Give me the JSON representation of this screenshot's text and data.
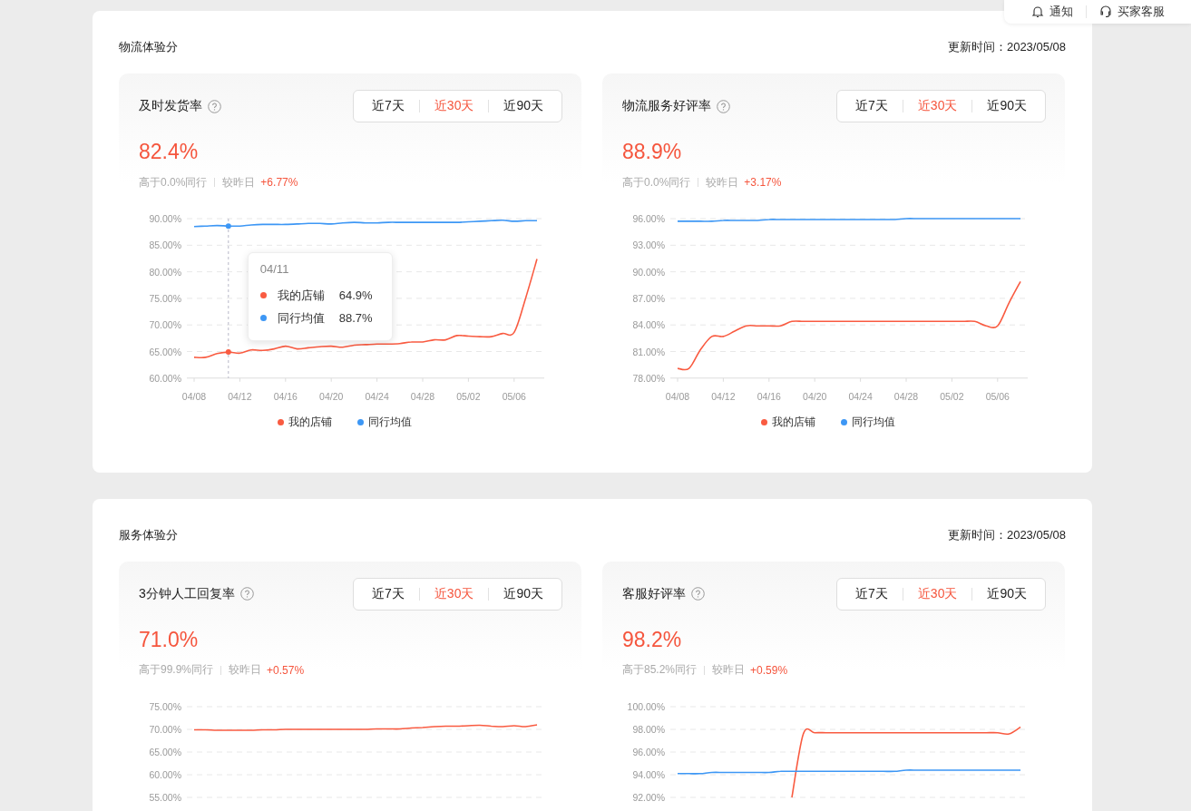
{
  "notice_bar": {
    "items": [
      {
        "kind": "bell",
        "label": "通知"
      },
      {
        "kind": "headset",
        "label": "买家客服"
      }
    ]
  },
  "sections": [
    {
      "title": "物流体验分",
      "updated": "更新时间：2023/05/08",
      "metrics": [
        {
          "title": "及时发货率",
          "ranges": [
            {
              "label": "近7天",
              "selected": false
            },
            {
              "label": "近30天",
              "selected": true
            },
            {
              "label": "近90天",
              "selected": false
            }
          ],
          "value": "82.4%",
          "peer_text": "高于0.0%同行",
          "compare_label": "较昨日",
          "compare_value": "+6.77%",
          "tooltip": {
            "date": "04/11",
            "rows": [
              {
                "label": "我的店铺",
                "value": "64.9%",
                "color": "#f95b41"
              },
              {
                "label": "同行均值",
                "value": "88.7%",
                "color": "#3d97f5"
              }
            ]
          },
          "chart_data": {
            "type": "line",
            "grid": true,
            "legend": true,
            "categories": [
              "04/08",
              null,
              null,
              null,
              "04/12",
              null,
              null,
              null,
              "04/16",
              null,
              null,
              null,
              "04/20",
              null,
              null,
              null,
              "04/24",
              null,
              null,
              null,
              "04/28",
              null,
              null,
              null,
              "05/02",
              null,
              null,
              null,
              "05/06",
              null,
              null
            ],
            "ylim": [
              60,
              90
            ],
            "yticks": [
              {
                "value": 60,
                "label": "60.00%"
              },
              {
                "value": 65,
                "label": "65.00%"
              },
              {
                "value": 70,
                "label": "70.00%"
              },
              {
                "value": 75,
                "label": "75.00%"
              },
              {
                "value": 80,
                "label": "80.00%"
              },
              {
                "value": 85,
                "label": "85.00%"
              },
              {
                "value": 90,
                "label": "90.00%"
              }
            ],
            "series": [
              {
                "name": "我的店铺",
                "color": "#f95b41",
                "values": [
                  63.9,
                  63.9,
                  64.6,
                  64.9,
                  64.7,
                  65.3,
                  65.2,
                  65.5,
                  66.0,
                  65.5,
                  65.7,
                  65.9,
                  66.0,
                  65.8,
                  66.2,
                  66.3,
                  66.4,
                  66.4,
                  66.5,
                  66.8,
                  66.8,
                  67.2,
                  67.2,
                  68.0,
                  67.9,
                  67.8,
                  67.8,
                  68.4,
                  68.6,
                  75.0,
                  82.4
                ]
              },
              {
                "name": "同行均值",
                "color": "#3d97f5",
                "values": [
                  88.5,
                  88.6,
                  88.7,
                  88.6,
                  88.6,
                  88.8,
                  88.9,
                  88.9,
                  88.9,
                  89.0,
                  89.1,
                  89.1,
                  89.0,
                  89.2,
                  89.3,
                  89.2,
                  89.2,
                  89.3,
                  89.3,
                  89.3,
                  89.3,
                  89.3,
                  89.3,
                  89.3,
                  89.4,
                  89.5,
                  89.6,
                  89.7,
                  89.5,
                  89.6,
                  89.6
                ]
              }
            ]
          }
        },
        {
          "title": "物流服务好评率",
          "ranges": [
            {
              "label": "近7天",
              "selected": false
            },
            {
              "label": "近30天",
              "selected": true
            },
            {
              "label": "近90天",
              "selected": false
            }
          ],
          "value": "88.9%",
          "peer_text": "高于0.0%同行",
          "compare_label": "较昨日",
          "compare_value": "+3.17%",
          "chart_data": {
            "type": "line",
            "grid": true,
            "legend": true,
            "categories": [
              "04/08",
              null,
              null,
              null,
              "04/12",
              null,
              null,
              null,
              "04/16",
              null,
              null,
              null,
              "04/20",
              null,
              null,
              null,
              "04/24",
              null,
              null,
              null,
              "04/28",
              null,
              null,
              null,
              "05/02",
              null,
              null,
              null,
              "05/06",
              null,
              null
            ],
            "ylim": [
              78,
              96
            ],
            "yticks": [
              {
                "value": 78,
                "label": "78.00%"
              },
              {
                "value": 81,
                "label": "81.00%"
              },
              {
                "value": 84,
                "label": "84.00%"
              },
              {
                "value": 87,
                "label": "87.00%"
              },
              {
                "value": 90,
                "label": "90.00%"
              },
              {
                "value": 93,
                "label": "93.00%"
              },
              {
                "value": 96,
                "label": "96.00%"
              }
            ],
            "series": [
              {
                "name": "我的店铺",
                "color": "#f95b41",
                "values": [
                  79.1,
                  79.1,
                  81.2,
                  82.7,
                  82.7,
                  83.3,
                  83.9,
                  83.9,
                  83.9,
                  83.9,
                  84.4,
                  84.4,
                  84.4,
                  84.4,
                  84.4,
                  84.4,
                  84.4,
                  84.4,
                  84.4,
                  84.4,
                  84.4,
                  84.4,
                  84.4,
                  84.4,
                  84.4,
                  84.4,
                  84.4,
                  83.9,
                  83.9,
                  86.5,
                  88.9
                ]
              },
              {
                "name": "同行均值",
                "color": "#3d97f5",
                "values": [
                  95.7,
                  95.7,
                  95.7,
                  95.7,
                  95.8,
                  95.8,
                  95.8,
                  95.8,
                  95.9,
                  95.9,
                  95.9,
                  95.9,
                  95.9,
                  95.9,
                  95.9,
                  95.9,
                  95.9,
                  95.9,
                  95.9,
                  95.9,
                  96.0,
                  96.0,
                  96.0,
                  96.0,
                  96.0,
                  96.0,
                  96.0,
                  96.0,
                  96.0,
                  96.0,
                  96.0
                ]
              }
            ]
          }
        }
      ]
    },
    {
      "title": "服务体验分",
      "updated": "更新时间：2023/05/08",
      "metrics": [
        {
          "title": "3分钟人工回复率",
          "ranges": [
            {
              "label": "近7天",
              "selected": false
            },
            {
              "label": "近30天",
              "selected": true
            },
            {
              "label": "近90天",
              "selected": false
            }
          ],
          "value": "71.0%",
          "peer_text": "高于99.9%同行",
          "compare_label": "较昨日",
          "compare_value": "+0.57%",
          "chart_data": {
            "type": "line",
            "grid": true,
            "ylim": [
              55,
              75
            ],
            "yticks": [
              {
                "value": 55,
                "label": "55.00%"
              },
              {
                "value": 60,
                "label": "60.00%"
              },
              {
                "value": 65,
                "label": "65.00%"
              },
              {
                "value": 70,
                "label": "70.00%"
              },
              {
                "value": 75,
                "label": "75.00%"
              }
            ],
            "series": [
              {
                "color": "#f95b41",
                "values": [
                  69.9,
                  69.9,
                  69.8,
                  69.8,
                  69.8,
                  69.8,
                  69.9,
                  69.9,
                  70.0,
                  70.0,
                  70.0,
                  70.0,
                  70.0,
                  70.0,
                  70.0,
                  70.0,
                  70.1,
                  70.1,
                  70.1,
                  70.3,
                  70.4,
                  70.6,
                  70.7,
                  70.7,
                  70.8,
                  70.9,
                  70.7,
                  70.6,
                  70.8,
                  70.6,
                  71.0
                ]
              }
            ]
          }
        },
        {
          "title": "客服好评率",
          "ranges": [
            {
              "label": "近7天",
              "selected": false
            },
            {
              "label": "近30天",
              "selected": true
            },
            {
              "label": "近90天",
              "selected": false
            }
          ],
          "value": "98.2%",
          "peer_text": "高于85.2%同行",
          "compare_label": "较昨日",
          "compare_value": "+0.59%",
          "chart_data": {
            "type": "line",
            "grid": true,
            "ylim": [
              92,
              100
            ],
            "yticks": [
              {
                "value": 92,
                "label": "92.00%"
              },
              {
                "value": 94,
                "label": "94.00%"
              },
              {
                "value": 96,
                "label": "96.00%"
              },
              {
                "value": 98,
                "label": "98.00%"
              },
              {
                "value": 100,
                "label": "100.00%"
              }
            ],
            "series": [
              {
                "color": "#f95b41",
                "values": [
                  null,
                  null,
                  null,
                  null,
                  null,
                  null,
                  null,
                  null,
                  null,
                  null,
                  92.0,
                  97.6,
                  97.7,
                  97.7,
                  97.7,
                  97.7,
                  97.7,
                  97.7,
                  97.7,
                  97.7,
                  97.7,
                  97.7,
                  97.7,
                  97.7,
                  97.7,
                  97.7,
                  97.7,
                  97.7,
                  97.7,
                  97.6,
                  98.2
                ]
              },
              {
                "color": "#3d97f5",
                "values": [
                  94.1,
                  94.1,
                  94.1,
                  94.2,
                  94.2,
                  94.2,
                  94.2,
                  94.2,
                  94.2,
                  94.3,
                  94.3,
                  94.3,
                  94.3,
                  94.3,
                  94.3,
                  94.3,
                  94.3,
                  94.3,
                  94.3,
                  94.3,
                  94.4,
                  94.4,
                  94.4,
                  94.4,
                  94.4,
                  94.4,
                  94.4,
                  94.4,
                  94.4,
                  94.4,
                  94.4
                ]
              }
            ]
          }
        }
      ]
    }
  ]
}
